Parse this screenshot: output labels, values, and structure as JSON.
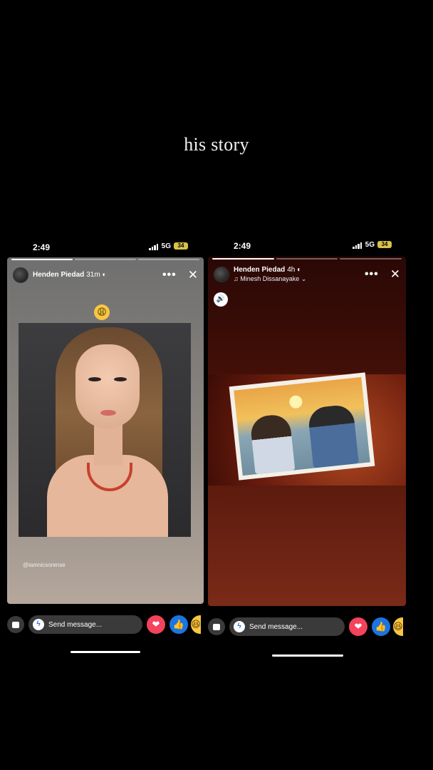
{
  "caption": "his story",
  "left_story": {
    "status": {
      "time": "2:49",
      "network": "5G",
      "battery": "34"
    },
    "progress": {
      "segments": 3,
      "completed": 1
    },
    "user": {
      "name": "Henden Piedad",
      "age": "31m"
    },
    "emoji": "😩",
    "photo_credit": "@iamnicsorense",
    "reply": {
      "placeholder": "Send message..."
    },
    "reactions": [
      "heart-icon",
      "like-icon",
      "haha-icon"
    ]
  },
  "right_story": {
    "status": {
      "time": "2:49",
      "network": "5G",
      "battery": "34"
    },
    "progress": {
      "segments": 3,
      "completed": 1
    },
    "user": {
      "name": "Henden Piedad",
      "age": "4h"
    },
    "music": "♫ Minesh Dissanayake ⌄",
    "reply": {
      "placeholder": "Send message..."
    },
    "reactions": [
      "heart-icon",
      "like-icon",
      "haha-icon"
    ]
  },
  "icons": {
    "more": "•••",
    "close": "✕",
    "speaker": "🔊",
    "messenger": "ϟ",
    "heart": "❤",
    "like": "👍",
    "haha": "😆"
  }
}
